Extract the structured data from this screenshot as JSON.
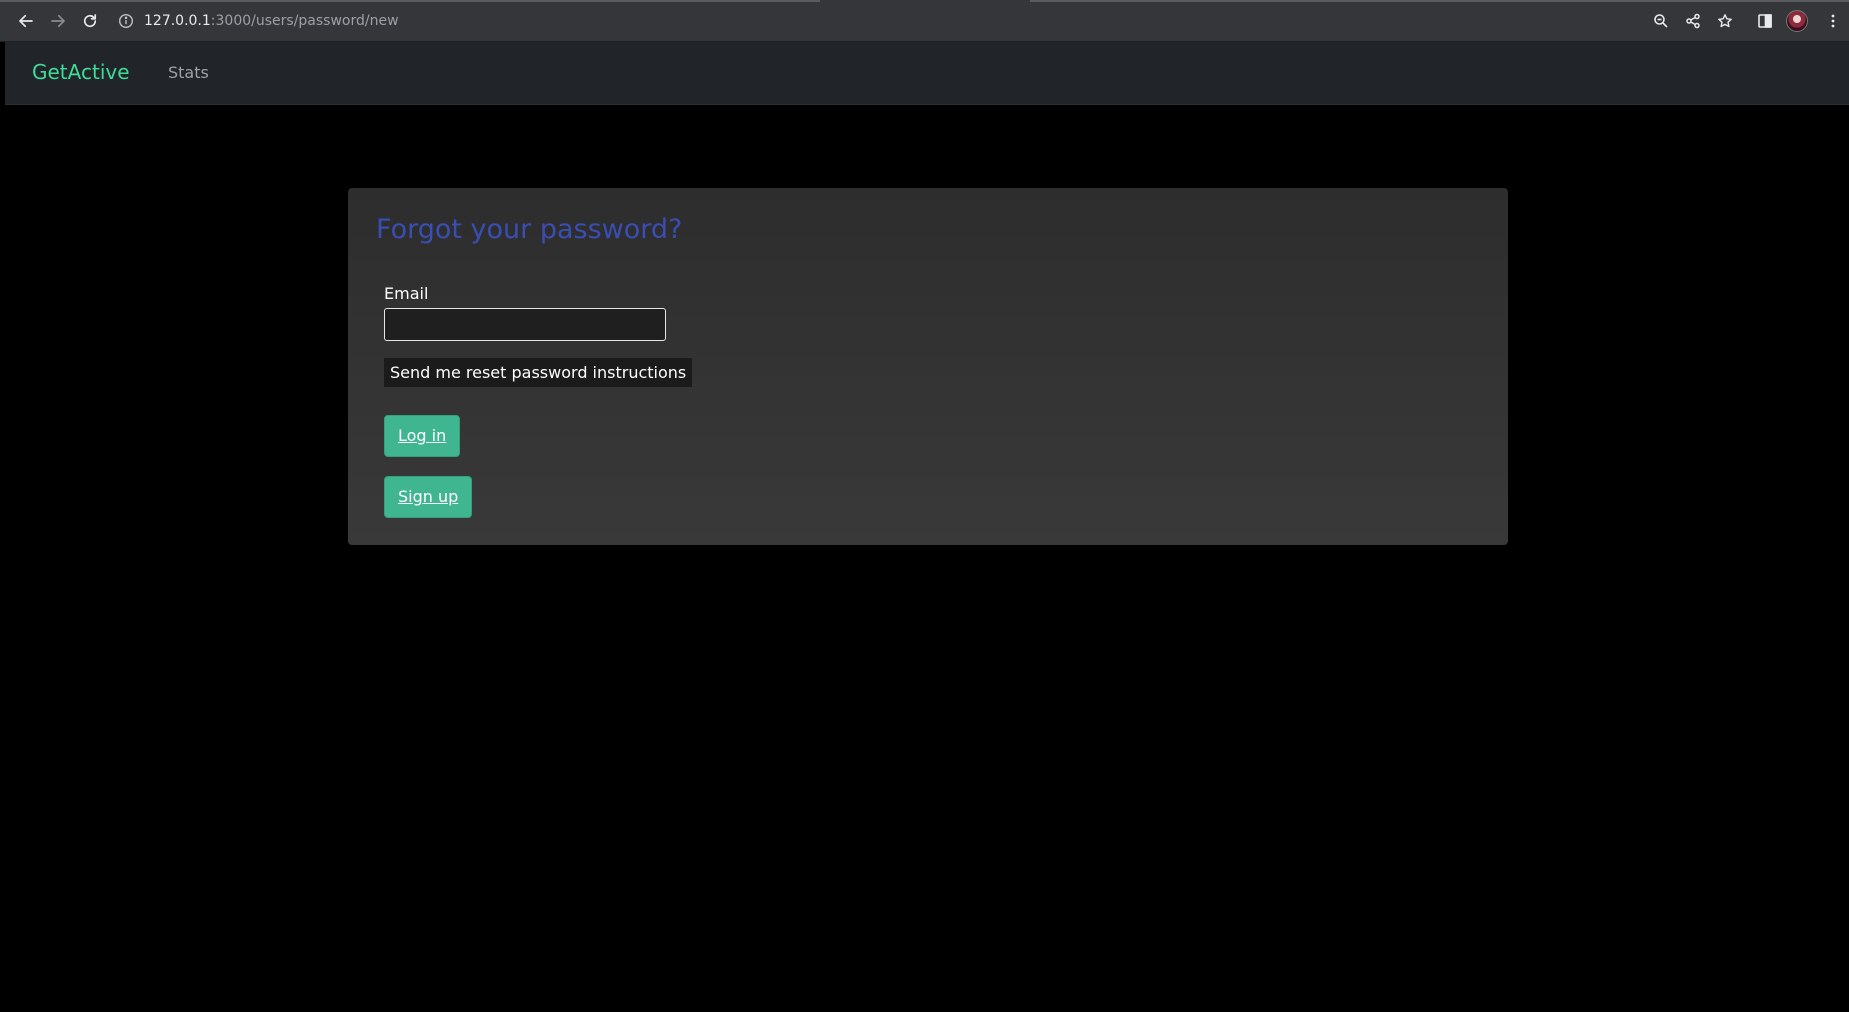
{
  "browser": {
    "url_host": "127.0.0.1",
    "url_path": ":3000/users/password/new",
    "icons": [
      "back-arrow-icon",
      "forward-arrow-icon",
      "reload-icon",
      "site-info-icon",
      "zoom-icon",
      "share-icon",
      "bookmark-star-icon",
      "side-panel-icon",
      "profile-avatar",
      "menu-kebab-icon"
    ]
  },
  "navbar": {
    "brand": "GetActive",
    "links": [
      {
        "label": "Stats"
      }
    ]
  },
  "page": {
    "heading": "Forgot your password?",
    "form": {
      "email_label": "Email",
      "email_value": "",
      "submit_label": "Send me reset password instructions"
    },
    "links": {
      "login_label": "Log in",
      "signup_label": "Sign up"
    }
  },
  "colors": {
    "brand": "#3ddc97",
    "heading": "#3a4db3",
    "button_green": "#3fb68f",
    "navbar_bg": "#212529",
    "page_bg": "#000000",
    "card_bg": "#333333"
  }
}
